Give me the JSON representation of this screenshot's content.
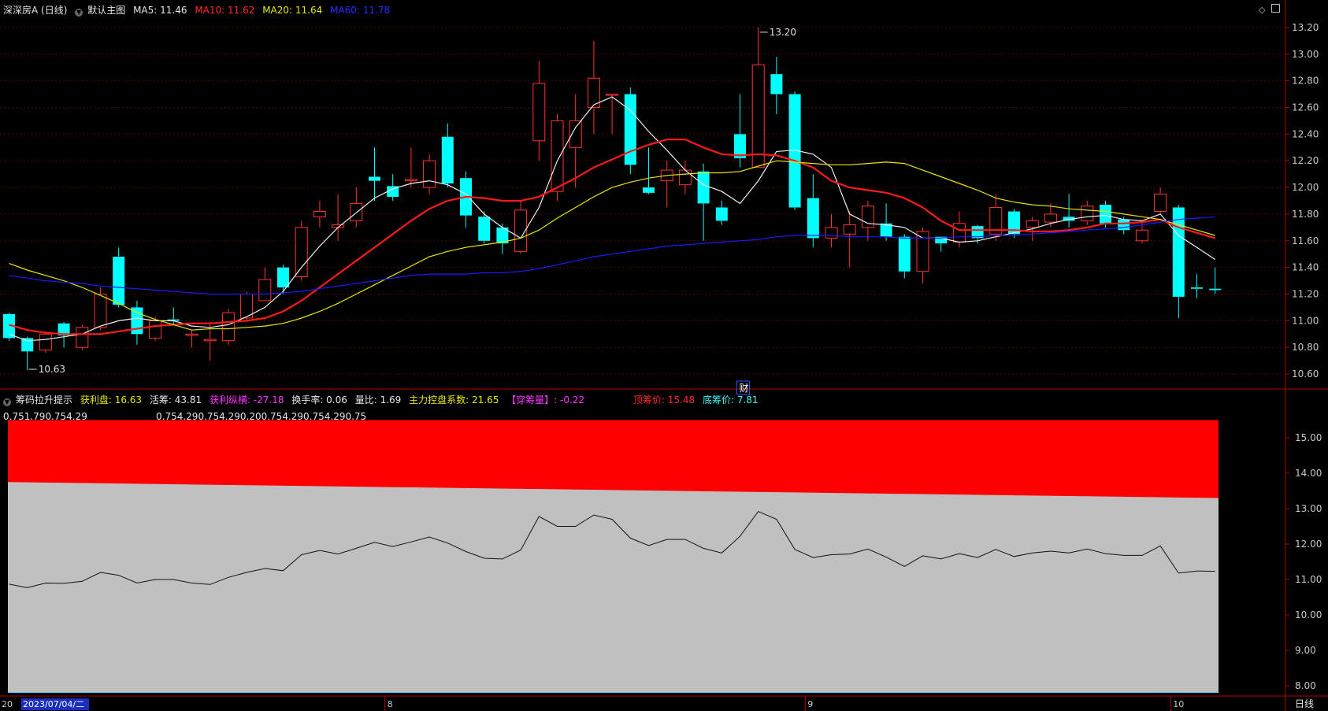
{
  "main_header": {
    "security": "深深房A (日线)",
    "template": "默认主图",
    "ma5": "MA5: 11.46",
    "ma10": "MA10: 11.62",
    "ma20": "MA20: 11.64",
    "ma60": "MA60: 11.78"
  },
  "sub_header": {
    "indicator": "筹码拉升提示",
    "profit_chips": "获利盘: 16.63",
    "active_chips": "活筹: 43.81",
    "profit_vertical": "获利纵横: -27.18",
    "turnover": "换手率: 0.06",
    "volume_ratio": "量比: 1.69",
    "control_coef": "主力控盘系数: 21.65",
    "pierce_chips": "【穿筹量】: -0.22",
    "top_price": "顶筹价: 15.48",
    "bottom_price": "底筹价: 7.81"
  },
  "sub_values_left": "0.751.790.754.29",
  "sub_values_mid": "0.754.290.754.290.200.754.290.754.290.75",
  "date_cursor": "2023/07/04/二",
  "date_prefix": "20",
  "month_labels": [
    {
      "label": "8",
      "index": 21
    },
    {
      "label": "9",
      "index": 44
    },
    {
      "label": "10",
      "index": 64
    }
  ],
  "period_label": "日线",
  "finance_marker": "财",
  "colors": {
    "up": "#ff3232",
    "down": "#00ffff",
    "ma5": "#f0f0f0",
    "ma10": "#ff1a1a",
    "ma20": "#e6e600",
    "ma60": "#1a1aff",
    "sub_red": "#ff0000",
    "sub_gray": "#c0c0c0"
  },
  "chart_data": [
    {
      "type": "candlestick",
      "title": "深深房A (日线)",
      "ylim": [
        10.5,
        13.3
      ],
      "y_ticks": [
        10.6,
        10.8,
        11.0,
        11.2,
        11.4,
        11.6,
        11.8,
        12.0,
        12.2,
        12.4,
        12.6,
        12.8,
        13.0,
        13.2
      ],
      "annotations": [
        {
          "text": "13.20",
          "index": 41,
          "value": 13.2
        },
        {
          "text": "10.63",
          "index": 1,
          "value": 10.63
        }
      ],
      "candles": [
        [
          11.05,
          10.87,
          11.06,
          10.85
        ],
        [
          10.87,
          10.77,
          10.88,
          10.63
        ],
        [
          10.78,
          10.9,
          10.92,
          10.76
        ],
        [
          10.98,
          10.89,
          10.99,
          10.8
        ],
        [
          10.8,
          10.95,
          10.97,
          10.78
        ],
        [
          10.95,
          11.2,
          11.25,
          10.93
        ],
        [
          11.48,
          11.12,
          11.55,
          11.1
        ],
        [
          11.1,
          10.9,
          11.15,
          10.82
        ],
        [
          10.87,
          11.0,
          11.03,
          10.85
        ],
        [
          11.01,
          11.0,
          11.1,
          10.97
        ],
        [
          10.89,
          10.9,
          10.93,
          10.8
        ],
        [
          10.85,
          10.86,
          10.99,
          10.7
        ],
        [
          10.85,
          11.06,
          11.09,
          10.82
        ],
        [
          11.02,
          11.2,
          11.22,
          11.0
        ],
        [
          11.15,
          11.31,
          11.4,
          11.15
        ],
        [
          11.4,
          11.25,
          11.42,
          11.2
        ],
        [
          11.33,
          11.7,
          11.75,
          11.3
        ],
        [
          11.78,
          11.82,
          11.9,
          11.7
        ],
        [
          11.7,
          11.72,
          11.95,
          11.6
        ],
        [
          11.75,
          11.88,
          12.0,
          11.7
        ],
        [
          12.08,
          12.05,
          12.3,
          11.9
        ],
        [
          12.01,
          11.93,
          12.1,
          11.9
        ],
        [
          12.05,
          12.06,
          12.3,
          12.0
        ],
        [
          12.0,
          12.2,
          12.25,
          11.95
        ],
        [
          12.38,
          12.03,
          12.48,
          12.0
        ],
        [
          12.07,
          11.79,
          12.12,
          11.7
        ],
        [
          11.78,
          11.6,
          11.82,
          11.58
        ],
        [
          11.7,
          11.58,
          11.73,
          11.5
        ],
        [
          11.52,
          11.83,
          11.9,
          11.5
        ],
        [
          12.35,
          12.78,
          12.95,
          12.2
        ],
        [
          11.97,
          12.5,
          12.55,
          11.9
        ],
        [
          12.3,
          12.5,
          12.7,
          12.0
        ],
        [
          12.6,
          12.82,
          13.1,
          12.4
        ],
        [
          12.7,
          12.7,
          12.7,
          12.4
        ],
        [
          12.7,
          12.17,
          12.75,
          12.1
        ],
        [
          12.0,
          11.96,
          12.3,
          11.95
        ],
        [
          12.05,
          12.13,
          12.2,
          11.85
        ],
        [
          12.02,
          12.13,
          12.2,
          11.95
        ],
        [
          12.12,
          11.88,
          12.18,
          11.6
        ],
        [
          11.85,
          11.75,
          11.9,
          11.72
        ],
        [
          12.4,
          12.22,
          12.7,
          12.15
        ],
        [
          12.15,
          12.92,
          13.2,
          12.15
        ],
        [
          12.85,
          12.7,
          12.98,
          12.55
        ],
        [
          12.7,
          11.85,
          12.72,
          11.83
        ],
        [
          11.92,
          11.62,
          12.1,
          11.55
        ],
        [
          11.62,
          11.7,
          11.8,
          11.55
        ],
        [
          11.65,
          11.72,
          11.82,
          11.4
        ],
        [
          11.7,
          11.86,
          11.9,
          11.6
        ],
        [
          11.73,
          11.63,
          11.88,
          11.6
        ],
        [
          11.63,
          11.37,
          11.65,
          11.32
        ],
        [
          11.37,
          11.67,
          11.7,
          11.28
        ],
        [
          11.63,
          11.58,
          11.63,
          11.52
        ],
        [
          11.59,
          11.73,
          11.82,
          11.55
        ],
        [
          11.71,
          11.62,
          11.72,
          11.58
        ],
        [
          11.65,
          11.85,
          11.95,
          11.6
        ],
        [
          11.82,
          11.65,
          11.84,
          11.62
        ],
        [
          11.7,
          11.75,
          11.78,
          11.6
        ],
        [
          11.74,
          11.8,
          11.88,
          11.7
        ],
        [
          11.78,
          11.75,
          11.95,
          11.7
        ],
        [
          11.75,
          11.86,
          11.9,
          11.72
        ],
        [
          11.87,
          11.73,
          11.9,
          11.7
        ],
        [
          11.76,
          11.68,
          11.78,
          11.65
        ],
        [
          11.6,
          11.68,
          11.75,
          11.58
        ],
        [
          11.82,
          11.95,
          12.0,
          11.8
        ],
        [
          11.85,
          11.18,
          11.87,
          11.02
        ],
        [
          11.25,
          11.24,
          11.35,
          11.17
        ],
        [
          11.24,
          11.23,
          11.4,
          11.2
        ]
      ],
      "series": [
        {
          "name": "MA5",
          "values": [
            10.9,
            10.85,
            10.86,
            10.88,
            10.9,
            10.96,
            11.0,
            11.02,
            11.0,
            11.0,
            10.96,
            10.95,
            10.97,
            11.03,
            11.1,
            11.22,
            11.4,
            11.56,
            11.7,
            11.81,
            11.92,
            11.99,
            12.03,
            12.05,
            12.02,
            11.95,
            11.8,
            11.7,
            11.62,
            11.85,
            12.2,
            12.45,
            12.62,
            12.68,
            12.58,
            12.42,
            12.28,
            12.13,
            12.02,
            11.97,
            11.88,
            12.05,
            12.27,
            12.28,
            12.25,
            12.15,
            11.8,
            11.73,
            11.72,
            11.7,
            11.62,
            11.62,
            11.59,
            11.6,
            11.63,
            11.66,
            11.69,
            11.73,
            11.76,
            11.78,
            11.79,
            11.76,
            11.75,
            11.8,
            11.64,
            11.55,
            11.46
          ]
        },
        {
          "name": "MA10",
          "values": [
            10.97,
            10.93,
            10.91,
            10.9,
            10.9,
            10.9,
            10.92,
            10.94,
            10.96,
            10.97,
            10.98,
            10.98,
            10.99,
            11.0,
            11.02,
            11.07,
            11.15,
            11.25,
            11.35,
            11.45,
            11.55,
            11.65,
            11.75,
            11.84,
            11.9,
            11.93,
            11.92,
            11.9,
            11.9,
            11.93,
            12.0,
            12.07,
            12.15,
            12.21,
            12.27,
            12.32,
            12.36,
            12.36,
            12.3,
            12.25,
            12.24,
            12.25,
            12.24,
            12.2,
            12.15,
            12.05,
            12.0,
            11.98,
            11.96,
            11.92,
            11.85,
            11.75,
            11.68,
            11.68,
            11.68,
            11.68,
            11.67,
            11.67,
            11.68,
            11.7,
            11.73,
            11.73,
            11.74,
            11.76,
            11.7,
            11.66,
            11.62
          ]
        },
        {
          "name": "MA20",
          "values": [
            11.43,
            11.38,
            11.34,
            11.3,
            11.25,
            11.19,
            11.13,
            11.06,
            11.01,
            10.97,
            10.93,
            10.94,
            10.94,
            10.95,
            10.96,
            10.98,
            11.02,
            11.07,
            11.13,
            11.2,
            11.27,
            11.34,
            11.41,
            11.48,
            11.52,
            11.55,
            11.57,
            11.59,
            11.62,
            11.68,
            11.77,
            11.85,
            11.93,
            12.0,
            12.04,
            12.07,
            12.09,
            12.1,
            12.11,
            12.11,
            12.12,
            12.16,
            12.2,
            12.19,
            12.18,
            12.17,
            12.17,
            12.18,
            12.19,
            12.18,
            12.13,
            12.08,
            12.03,
            11.98,
            11.92,
            11.89,
            11.87,
            11.86,
            11.84,
            11.83,
            11.82,
            11.8,
            11.78,
            11.76,
            11.72,
            11.68,
            11.64
          ]
        },
        {
          "name": "MA60",
          "values": [
            11.34,
            11.32,
            11.3,
            11.29,
            11.28,
            11.26,
            11.25,
            11.24,
            11.23,
            11.22,
            11.21,
            11.2,
            11.2,
            11.2,
            11.2,
            11.21,
            11.22,
            11.24,
            11.26,
            11.28,
            11.3,
            11.32,
            11.34,
            11.35,
            11.35,
            11.35,
            11.36,
            11.36,
            11.37,
            11.39,
            11.42,
            11.45,
            11.48,
            11.5,
            11.52,
            11.54,
            11.56,
            11.57,
            11.58,
            11.59,
            11.6,
            11.61,
            11.63,
            11.64,
            11.64,
            11.64,
            11.63,
            11.63,
            11.63,
            11.62,
            11.62,
            11.62,
            11.63,
            11.63,
            11.64,
            11.64,
            11.65,
            11.66,
            11.67,
            11.68,
            11.69,
            11.7,
            11.72,
            11.74,
            11.76,
            11.77,
            11.78
          ]
        }
      ]
    },
    {
      "type": "area",
      "title": "筹码拉升提示",
      "ylim": [
        7.8,
        15.8
      ],
      "y_ticks": [
        8.0,
        9.0,
        10.0,
        11.0,
        12.0,
        13.0,
        14.0,
        15.0
      ],
      "red_band_top": [
        15.5,
        15.48
      ],
      "gray_band_top": [
        13.75,
        13.3
      ],
      "bottom": 7.81
    }
  ]
}
